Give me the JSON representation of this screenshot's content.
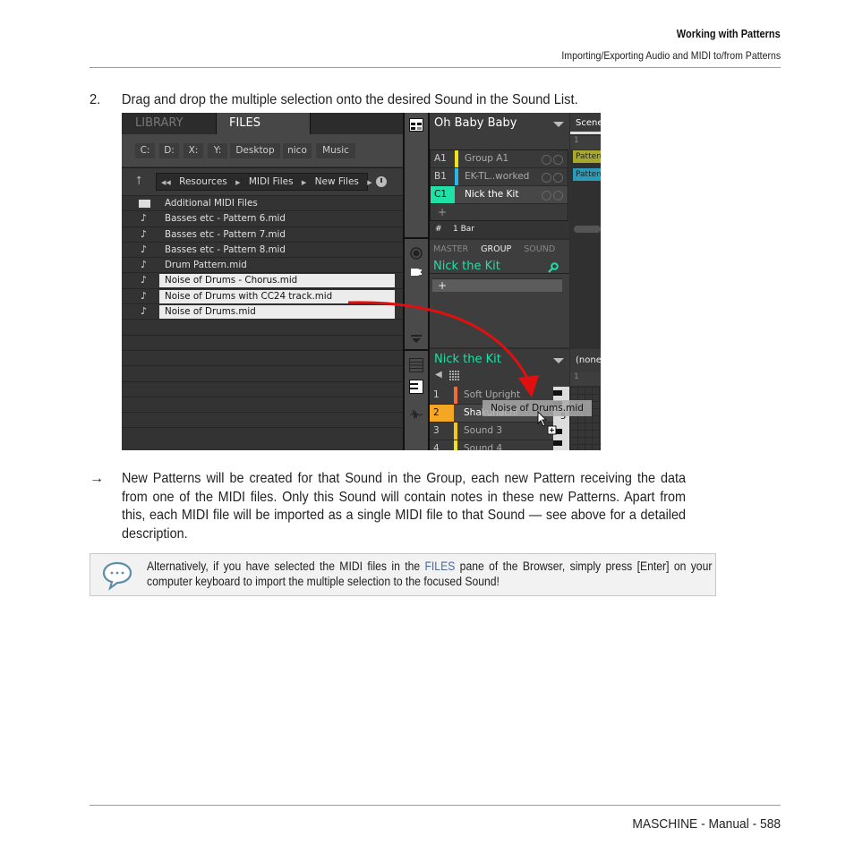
{
  "header": {
    "chapter": "Working with Patterns",
    "section": "Importing/Exporting Audio and MIDI to/from Patterns"
  },
  "step": {
    "number": "2.",
    "text": "Drag and drop the multiple selection onto the desired Sound in the Sound List."
  },
  "screenshot": {
    "browser": {
      "tabs": [
        "LIBRARY",
        "FILES"
      ],
      "active_tab": "FILES",
      "drives": [
        "C:",
        "D:",
        "X:",
        "Y:",
        "Desktop",
        "nico",
        "Music"
      ],
      "path": [
        "Resources",
        "MIDI Files",
        "New Files"
      ],
      "files": [
        {
          "name": "Additional MIDI Files",
          "type": "folder",
          "selected": false
        },
        {
          "name": "Basses etc - Pattern 6.mid",
          "type": "midi",
          "selected": false
        },
        {
          "name": "Basses etc - Pattern 7.mid",
          "type": "midi",
          "selected": false
        },
        {
          "name": "Basses etc - Pattern 8.mid",
          "type": "midi",
          "selected": false
        },
        {
          "name": "Drum Pattern.mid",
          "type": "midi",
          "selected": false
        },
        {
          "name": "Noise of Drums - Chorus.mid",
          "type": "midi",
          "selected": true
        },
        {
          "name": "Noise of Drums with CC24 track.mid",
          "type": "midi",
          "selected": true
        },
        {
          "name": "Noise of Drums.mid",
          "type": "midi",
          "selected": true
        }
      ]
    },
    "project": {
      "title": "Oh Baby Baby",
      "groups": [
        {
          "id": "A1",
          "name": "Group A1",
          "color": "#f2e21d",
          "active": false
        },
        {
          "id": "B1",
          "name": "EK-TL..worked",
          "color": "#29b6e8",
          "active": false
        },
        {
          "id": "C1",
          "name": "Nick the Kit",
          "color": "#1fe0a6",
          "active": true
        }
      ],
      "add_label": "+",
      "bar_length": "1 Bar"
    },
    "mixer": {
      "tabs": [
        "MASTER",
        "GROUP",
        "SOUND"
      ],
      "active_tab": "GROUP",
      "title": "Nick the Kit",
      "slot_label": "+"
    },
    "sounds": {
      "title": "Nick the Kit",
      "items": [
        {
          "id": "1",
          "name": "Soft Upright",
          "color": "#f26b3a",
          "active": false
        },
        {
          "id": "2",
          "name": "Shakuhachi",
          "color": "#f5a623",
          "active": true
        },
        {
          "id": "3",
          "name": "Sound 3",
          "color": "#f2c81d",
          "active": false
        },
        {
          "id": "4",
          "name": "Sound 4",
          "color": "#f2e21d",
          "active": false
        }
      ],
      "key_label": "5"
    },
    "arranger": {
      "scene_label": "Scene",
      "column": "1",
      "patterns": [
        {
          "label": "Pattern",
          "color": "#a8a82a"
        },
        {
          "label": "Pattern",
          "color": "#2a9bb8"
        }
      ],
      "pattern_slot": "(none)",
      "pattern_column": "1"
    },
    "drag_label": "Noise of Drums.mid"
  },
  "result": {
    "arrow": "→",
    "text": "New Patterns will be created for that Sound in the Group, each new Pattern receiving the data from one of the MIDI files. Only this Sound will contain notes in these new Patterns. Apart from this, each MIDI file will be imported as a single MIDI file to that Sound — see above for a detailed description."
  },
  "note": {
    "before": "Alternatively, if you have selected the MIDI files in the ",
    "highlight": "FILES",
    "after": " pane of the Browser, simply press [Enter] on your computer keyboard to import the multiple selection to the focused Sound!",
    "highlight_color": "#4c6c9c"
  },
  "footer": {
    "text": "MASCHINE - Manual - 588"
  }
}
